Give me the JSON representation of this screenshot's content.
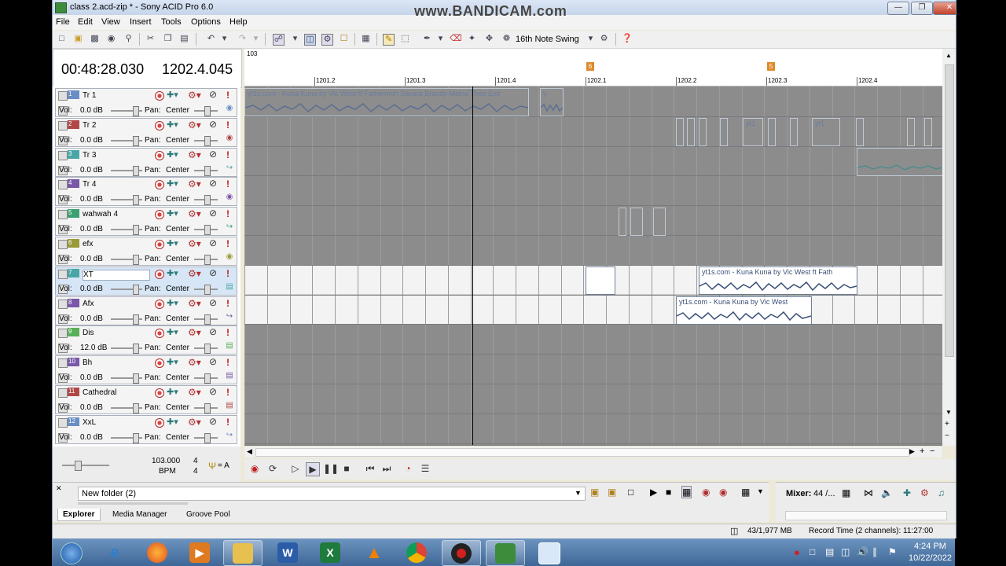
{
  "window": {
    "title": "class 2.acd-zip * - Sony ACID Pro 6.0",
    "watermark": "www.BANDICAM.com"
  },
  "menu": [
    "File",
    "Edit",
    "View",
    "Insert",
    "Tools",
    "Options",
    "Help"
  ],
  "toolbar": {
    "swing_label": "16th Note Swing"
  },
  "time_display": {
    "time": "00:48:28.030",
    "beat": "1202.4.045"
  },
  "tracks": [
    {
      "num": "1",
      "name": "Tr 1",
      "vol_label": "Vol:",
      "vol": "0.0 dB",
      "pan_label": "Pan:",
      "pan": "Center",
      "color": "#6a8ec4"
    },
    {
      "num": "2",
      "name": "Tr 2",
      "vol_label": "Vol:",
      "vol": "0.0 dB",
      "pan_label": "Pan:",
      "pan": "Center",
      "color": "#b04848"
    },
    {
      "num": "3",
      "name": "Tr 3",
      "vol_label": "Vol:",
      "vol": "0.0 dB",
      "pan_label": "Pan:",
      "pan": "Center",
      "color": "#4aa6a6"
    },
    {
      "num": "4",
      "name": "Tr 4",
      "vol_label": "Vol:",
      "vol": "0.0 dB",
      "pan_label": "Pan:",
      "pan": "Center",
      "color": "#7a58a8"
    },
    {
      "num": "5",
      "name": "wahwah 4",
      "vol_label": "Vol:",
      "vol": "0.0 dB",
      "pan_label": "Pan:",
      "pan": "Center",
      "color": "#3ca070"
    },
    {
      "num": "6",
      "name": "efx",
      "vol_label": "Vol:",
      "vol": "0.0 dB",
      "pan_label": "Pan:",
      "pan": "Center",
      "color": "#9a9a38"
    },
    {
      "num": "7",
      "name": "XT",
      "vol_label": "Vol:",
      "vol": "0.0 dB",
      "pan_label": "Pan:",
      "pan": "Center",
      "color": "#4aa6a6"
    },
    {
      "num": "8",
      "name": "Afx",
      "vol_label": "Vol:",
      "vol": "0.0 dB",
      "pan_label": "Pan:",
      "pan": "Center",
      "color": "#7a58a8"
    },
    {
      "num": "9",
      "name": "Dis",
      "vol_label": "Vol:",
      "vol": "12.0 dB",
      "pan_label": "Pan:",
      "pan": "Center",
      "color": "#5ab05a"
    },
    {
      "num": "10",
      "name": "Bh",
      "vol_label": "Vol:",
      "vol": "0.0 dB",
      "pan_label": "Pan:",
      "pan": "Center",
      "color": "#7a58a8"
    },
    {
      "num": "11",
      "name": "Cathedral",
      "vol_label": "Vol:",
      "vol": "0.0 dB",
      "pan_label": "Pan:",
      "pan": "Center",
      "color": "#b04848"
    },
    {
      "num": "12",
      "name": "XxL",
      "vol_label": "Vol:",
      "vol": "0.0 dB",
      "pan_label": "Pan:",
      "pan": "Center",
      "color": "#6a8ec4"
    }
  ],
  "tempo": {
    "bpm_value": "103.000",
    "bpm_label": "BPM",
    "time_sig_top": "4",
    "time_sig_bottom": "4",
    "key": "= A"
  },
  "ruler": {
    "top_label": "103",
    "labels": [
      "1201.2",
      "1201.3",
      "1201.4",
      "1202.1",
      "1202.2",
      "1202.3",
      "1202.4"
    ],
    "markers": [
      "6",
      "5"
    ]
  },
  "clips": {
    "tr1_a": "yt1s.com - Kuna Kuna by Vic West ft Fathermoh Savara Brandy Maina  Thee Exit",
    "tr1_b": "y",
    "tr2_a": "yt1",
    "tr2_b": "yt1",
    "xt_a": "yt1s.com - Kuna Kuna by Vic West ft Fath",
    "afx_a": "yt1s.com - Kuna Kuna by Vic West"
  },
  "explorer": {
    "folder": "New folder (2)",
    "tabs": [
      "Explorer",
      "Media Manager",
      "Groove Pool"
    ]
  },
  "mixer": {
    "label": "Mixer:",
    "value": "44 /..."
  },
  "status": {
    "memory": "43/1,977 MB",
    "record_time": "Record Time (2 channels): 11:27:00"
  },
  "taskbar": {
    "time": "4:24 PM",
    "date": "10/22/2022"
  }
}
